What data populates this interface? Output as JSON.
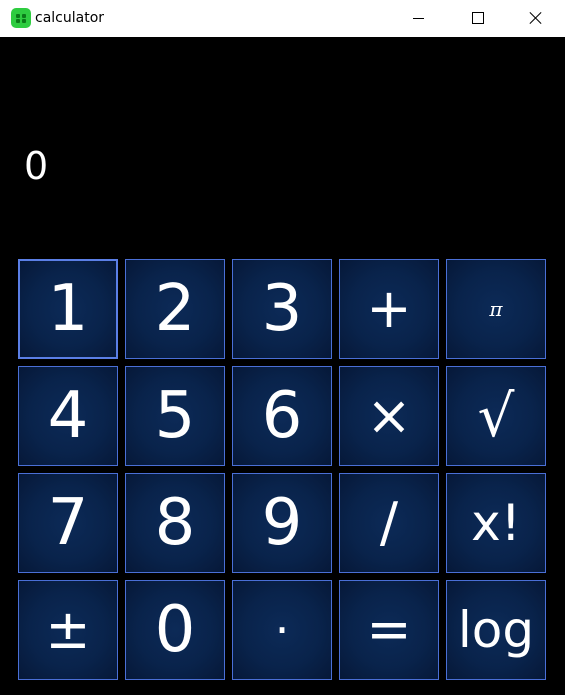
{
  "window": {
    "title": "calculator",
    "icon": "calculator-app-icon",
    "controls": [
      "minimize-icon",
      "maximize-icon",
      "close-icon"
    ]
  },
  "display": {
    "value": "0"
  },
  "keypad": {
    "rows": [
      [
        {
          "label": "1",
          "name": "key-1"
        },
        {
          "label": "2",
          "name": "key-2"
        },
        {
          "label": "3",
          "name": "key-3"
        },
        {
          "label": "+",
          "name": "key-add"
        },
        {
          "label": "π",
          "name": "key-pi"
        }
      ],
      [
        {
          "label": "4",
          "name": "key-4"
        },
        {
          "label": "5",
          "name": "key-5"
        },
        {
          "label": "6",
          "name": "key-6"
        },
        {
          "label": "×",
          "name": "key-multiply"
        },
        {
          "label": "√",
          "name": "key-sqrt"
        }
      ],
      [
        {
          "label": "7",
          "name": "key-7"
        },
        {
          "label": "8",
          "name": "key-8"
        },
        {
          "label": "9",
          "name": "key-9"
        },
        {
          "label": "/",
          "name": "key-divide"
        },
        {
          "label": "x!",
          "name": "key-factorial"
        }
      ],
      [
        {
          "label": "±",
          "name": "key-negate"
        },
        {
          "label": "0",
          "name": "key-0"
        },
        {
          "label": "·",
          "name": "key-decimal"
        },
        {
          "label": "=",
          "name": "key-equals"
        },
        {
          "label": "log",
          "name": "key-log"
        }
      ]
    ]
  },
  "colors": {
    "background": "#000000",
    "key_border": "#4a6fd6",
    "key_fill": "#09234b",
    "text": "#ffffff",
    "titlebar": "#ffffff",
    "app_icon": "#2ecc40"
  }
}
